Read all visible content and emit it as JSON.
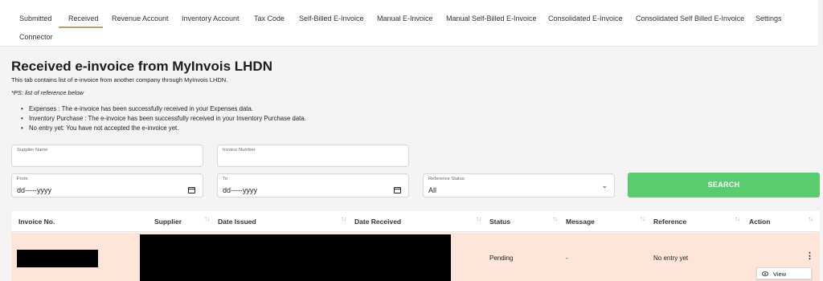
{
  "tabs": [
    {
      "label": "Submitted"
    },
    {
      "label": "Received"
    },
    {
      "label": "Revenue Account"
    },
    {
      "label": "Inventory Account"
    },
    {
      "label": "Tax Code"
    },
    {
      "label": "Self-Billed E-Invoice"
    },
    {
      "label": "Manual E-Invoice"
    },
    {
      "label": "Manual Self-Billed E-Invoice"
    },
    {
      "label": "Consolidated E-Invoice"
    },
    {
      "label": "Consolidated Self Billed E-Invoice"
    },
    {
      "label": "Settings"
    },
    {
      "label": "Connector"
    }
  ],
  "active_tab": "Received",
  "page": {
    "title": "Received e-invoice from MyInvois LHDN",
    "description": "This tab contains list of e-invoice from another company through MyInvois LHDN.",
    "ps": "*PS: list of reference below",
    "bullets": [
      "Expenses : The e-invoice has been successfully received in your Expenses data.",
      "Inventory Purchase : The e-invoice has been successfully received in your Inventory Purchase data.",
      "No entry yet: You have not accepted the e-invoice yet."
    ]
  },
  "filters": {
    "supplier_name": {
      "label": "Supplier Name",
      "value": ""
    },
    "invoice_number": {
      "label": "Invoice Number",
      "value": ""
    },
    "from": {
      "label": "From",
      "value": "dd-----yyyy"
    },
    "to": {
      "label": "To",
      "value": "dd-----yyyy"
    },
    "reference_status": {
      "label": "Reference Status",
      "value": "All"
    },
    "search_label": "SEARCH"
  },
  "table": {
    "columns": [
      "Invoice No.",
      "Supplier",
      "Date Issued",
      "Date Received",
      "Status",
      "Message",
      "Reference",
      "Action"
    ],
    "rows": [
      {
        "invoice_no": "",
        "supplier": "",
        "date_issued": "",
        "date_received": "",
        "status": "Pending",
        "message": "-",
        "reference": "No entry yet"
      }
    ]
  },
  "action_menu": {
    "view_label": "View"
  },
  "icons": {
    "calendar": "calendar-icon",
    "chevron": "chevron-down-icon",
    "sort": "sort-icon",
    "kebab": "kebab-menu-icon",
    "view": "eye-icon"
  },
  "colors": {
    "accent": "#b8a06a",
    "search_button": "#5bcb6f",
    "row_highlight": "#fde6d9"
  }
}
